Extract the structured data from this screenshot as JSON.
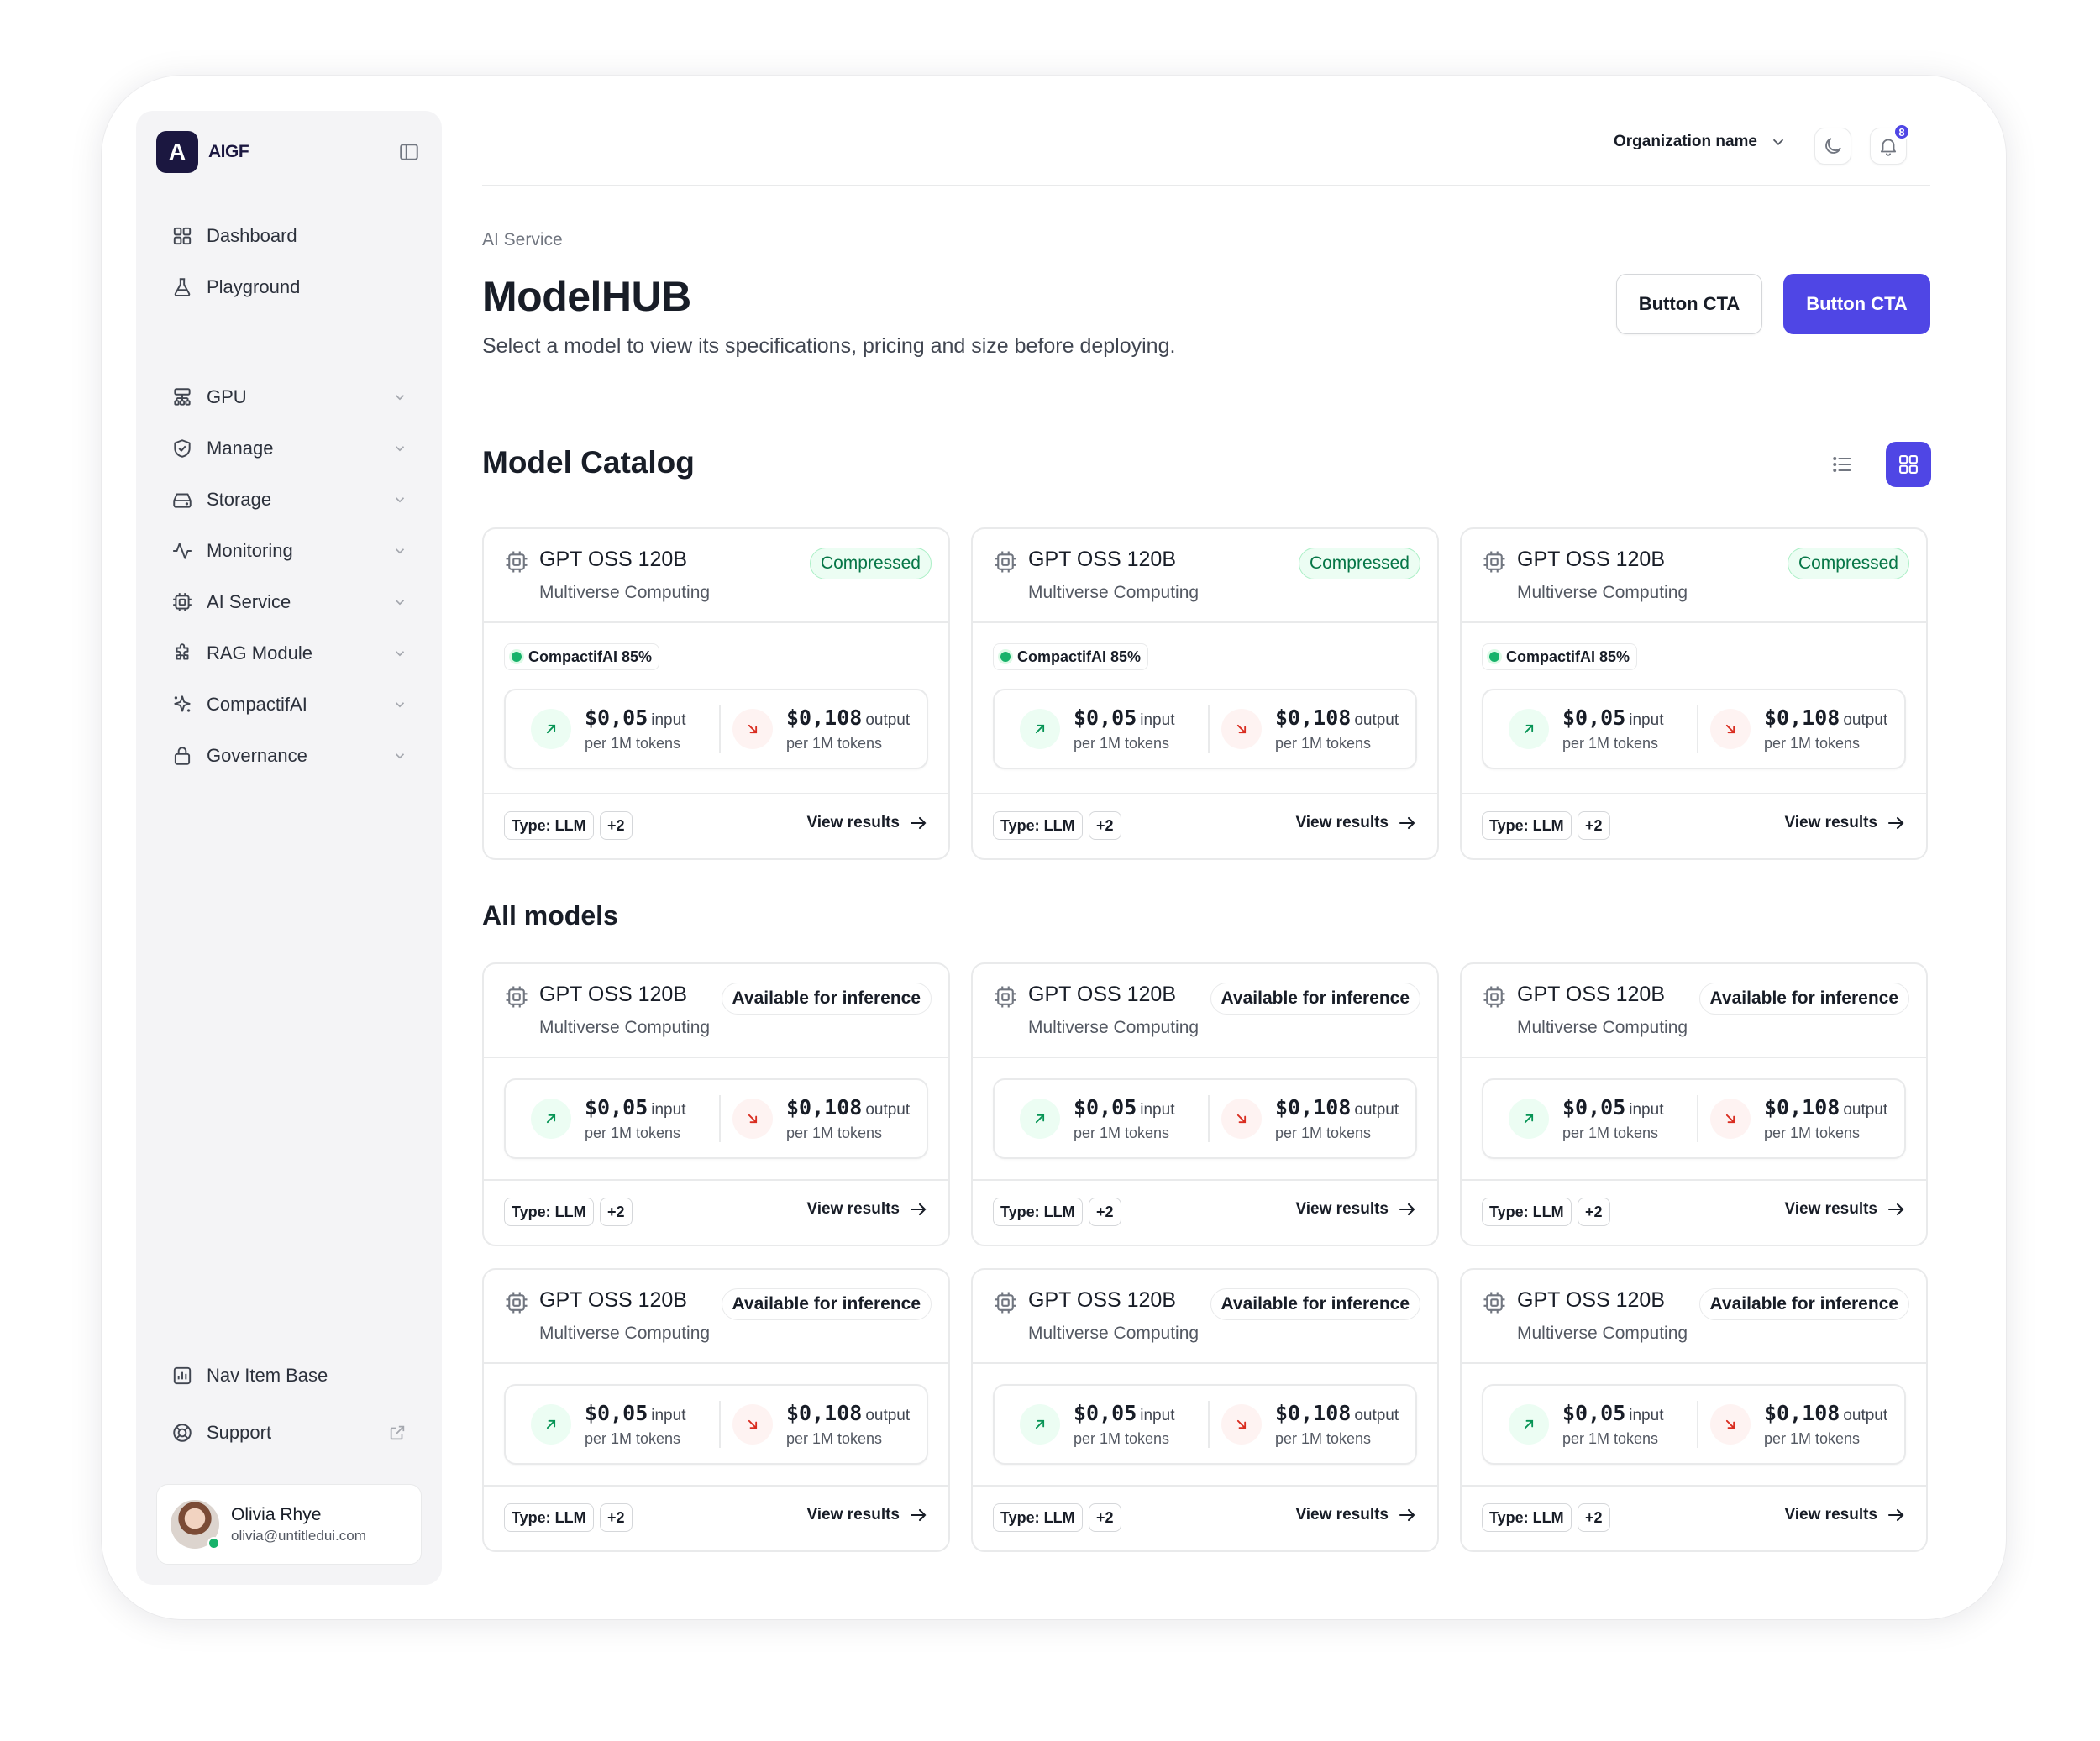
{
  "app": {
    "logo_letter": "A",
    "logo_name": "AIGF"
  },
  "sidebar": {
    "primary": [
      {
        "label": "Dashboard",
        "icon": "grid-icon"
      },
      {
        "label": "Playground",
        "icon": "flask-icon"
      }
    ],
    "sections": [
      {
        "label": "GPU",
        "icon": "gpu-icon"
      },
      {
        "label": "Manage",
        "icon": "shield-icon"
      },
      {
        "label": "Storage",
        "icon": "drive-icon"
      },
      {
        "label": "Monitoring",
        "icon": "activity-icon"
      },
      {
        "label": "AI Service",
        "icon": "chip-icon"
      },
      {
        "label": "RAG Module",
        "icon": "puzzle-icon"
      },
      {
        "label": "CompactifAI",
        "icon": "sparkle-icon"
      },
      {
        "label": "Governance",
        "icon": "lock-icon"
      }
    ],
    "footer": [
      {
        "label": "Nav Item Base",
        "icon": "chart-icon"
      },
      {
        "label": "Support",
        "icon": "lifebuoy-icon"
      }
    ],
    "user": {
      "name": "Olivia Rhye",
      "email": "olivia@untitledui.com"
    }
  },
  "header": {
    "org_name": "Organization name",
    "notification_count": "8"
  },
  "page": {
    "breadcrumb": "AI Service",
    "title": "ModelHUB",
    "subtitle": "Select a model to view its specifications, pricing and size before deploying.",
    "secondary_cta": "Button CTA",
    "primary_cta": "Button CTA"
  },
  "catalog": {
    "title": "Model Catalog",
    "cards": [
      {
        "name": "GPT OSS 120B",
        "vendor": "Multiverse Computing",
        "status": "Compressed",
        "compact": "CompactifAI 85%",
        "input_price": "$0,05",
        "input_label": "input",
        "input_sub": "per 1M tokens",
        "output_price": "$0,108",
        "output_label": "output",
        "output_sub": "per 1M tokens",
        "type": "Type: LLM",
        "more": "+2",
        "link": "View results"
      },
      {
        "name": "GPT OSS 120B",
        "vendor": "Multiverse Computing",
        "status": "Compressed",
        "compact": "CompactifAI 85%",
        "input_price": "$0,05",
        "input_label": "input",
        "input_sub": "per 1M tokens",
        "output_price": "$0,108",
        "output_label": "output",
        "output_sub": "per 1M tokens",
        "type": "Type: LLM",
        "more": "+2",
        "link": "View results"
      },
      {
        "name": "GPT OSS 120B",
        "vendor": "Multiverse Computing",
        "status": "Compressed",
        "compact": "CompactifAI 85%",
        "input_price": "$0,05",
        "input_label": "input",
        "input_sub": "per 1M tokens",
        "output_price": "$0,108",
        "output_label": "output",
        "output_sub": "per 1M tokens",
        "type": "Type: LLM",
        "more": "+2",
        "link": "View results"
      }
    ]
  },
  "all_models": {
    "title": "All models",
    "cards": [
      {
        "name": "GPT OSS 120B",
        "vendor": "Multiverse Computing",
        "status": "Available for inference",
        "input_price": "$0,05",
        "input_label": "input",
        "input_sub": "per 1M tokens",
        "output_price": "$0,108",
        "output_label": "output",
        "output_sub": "per 1M tokens",
        "type": "Type: LLM",
        "more": "+2",
        "link": "View results"
      },
      {
        "name": "GPT OSS 120B",
        "vendor": "Multiverse Computing",
        "status": "Available for inference",
        "input_price": "$0,05",
        "input_label": "input",
        "input_sub": "per 1M tokens",
        "output_price": "$0,108",
        "output_label": "output",
        "output_sub": "per 1M tokens",
        "type": "Type: LLM",
        "more": "+2",
        "link": "View results"
      },
      {
        "name": "GPT OSS 120B",
        "vendor": "Multiverse Computing",
        "status": "Available for inference",
        "input_price": "$0,05",
        "input_label": "input",
        "input_sub": "per 1M tokens",
        "output_price": "$0,108",
        "output_label": "output",
        "output_sub": "per 1M tokens",
        "type": "Type: LLM",
        "more": "+2",
        "link": "View results"
      },
      {
        "name": "GPT OSS 120B",
        "vendor": "Multiverse Computing",
        "status": "Available for inference",
        "input_price": "$0,05",
        "input_label": "input",
        "input_sub": "per 1M tokens",
        "output_price": "$0,108",
        "output_label": "output",
        "output_sub": "per 1M tokens",
        "type": "Type: LLM",
        "more": "+2",
        "link": "View results"
      },
      {
        "name": "GPT OSS 120B",
        "vendor": "Multiverse Computing",
        "status": "Available for inference",
        "input_price": "$0,05",
        "input_label": "input",
        "input_sub": "per 1M tokens",
        "output_price": "$0,108",
        "output_label": "output",
        "output_sub": "per 1M tokens",
        "type": "Type: LLM",
        "more": "+2",
        "link": "View results"
      },
      {
        "name": "GPT OSS 120B",
        "vendor": "Multiverse Computing",
        "status": "Available for inference",
        "input_price": "$0,05",
        "input_label": "input",
        "input_sub": "per 1M tokens",
        "output_price": "$0,108",
        "output_label": "output",
        "output_sub": "per 1M tokens",
        "type": "Type: LLM",
        "more": "+2",
        "link": "View results"
      }
    ]
  },
  "colors": {
    "accent": "#4f46e5",
    "success": "#17b26a",
    "danger": "#f04438",
    "border": "#e9eaeb"
  }
}
